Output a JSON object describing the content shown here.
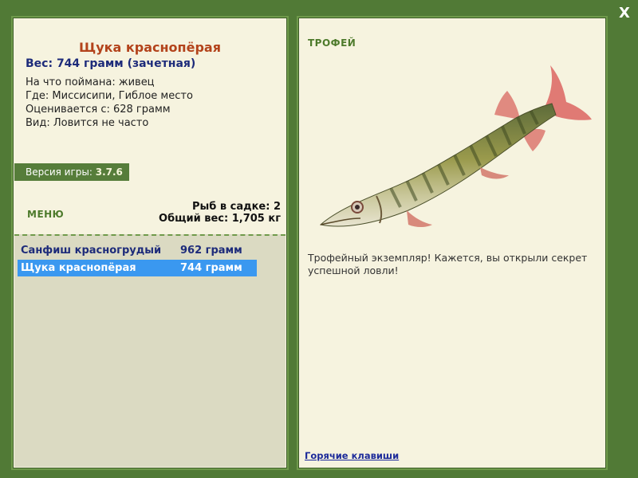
{
  "window": {
    "close_icon": "close-icon",
    "close_label": "X"
  },
  "fish": {
    "name": "Щука краснопёрая",
    "weight_line": "Вес: 744 грамм (зачетная)",
    "info": [
      "На что поймана: живец",
      "Где: Миссисипи, Гиблое место",
      "Оценивается с: 628 грамм",
      "Вид: Ловится не часто"
    ]
  },
  "version": {
    "label": "Версия игры:",
    "number": "3.7.6"
  },
  "menu_label": "МЕНЮ",
  "keep": {
    "count_line": "Рыб в садке: 2",
    "total_line": "Общий вес: 1,705 кг"
  },
  "catch_list": [
    {
      "name": "Санфиш красногрудый",
      "weight": "962 грамм",
      "selected": false
    },
    {
      "name": "Щука краснопёрая",
      "weight": "744 грамм",
      "selected": true
    }
  ],
  "trophy": {
    "label": "ТРОФЕЙ",
    "description": "Трофейный экземпляр! Кажется, вы открыли секрет успешной ловли!"
  },
  "hotkeys_link": "Горячие клавиши",
  "colors": {
    "frame": "#517a36",
    "panel": "#f6f3df",
    "title": "#b3431b",
    "accent_text": "#1d2b7a",
    "selected_row": "#3a98f0"
  }
}
